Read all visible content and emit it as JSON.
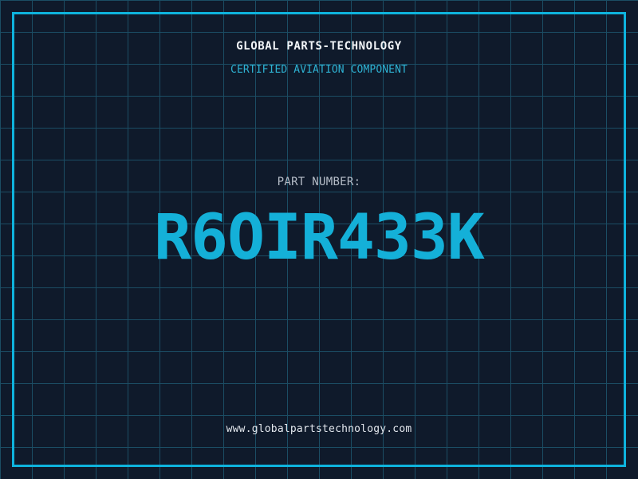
{
  "header": {
    "title": "GLOBAL PARTS-TECHNOLOGY",
    "subtitle": "CERTIFIED AVIATION COMPONENT"
  },
  "part": {
    "label": "PART NUMBER:",
    "number": "R6OIR433K"
  },
  "footer": {
    "url": "www.globalpartstechnology.com"
  },
  "theme": {
    "background_color": "#0f1a2b",
    "grid_line_color": "#1b4d64",
    "frame_border_color": "#0eb3dd",
    "accent_cyan": "#14b0d8",
    "subtitle_cyan": "#2eb3d4",
    "title_white": "#f2f5f8",
    "label_gray": "#b6bdc8",
    "grid_spacing_px": 40
  }
}
